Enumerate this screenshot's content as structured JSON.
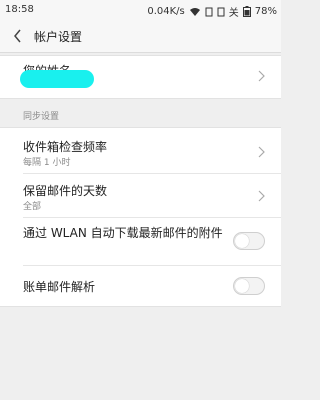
{
  "status_bar": {
    "time": "18:58",
    "speed": "0.04K/s",
    "icons": [
      "wifi-icon",
      "sim-icon",
      "sim2-icon",
      "battery-icon"
    ],
    "alarm": "关",
    "battery": "78%"
  },
  "header": {
    "title": "帐户设置"
  },
  "profile": {
    "name_label": "您的姓名"
  },
  "sync": {
    "section_title": "同步设置",
    "items": [
      {
        "label": "收件箱检查频率",
        "value": "每隔 1 小时"
      },
      {
        "label": "保留邮件的天数",
        "value": "全部"
      },
      {
        "label": "通过 WLAN 自动下载最新邮件的附件",
        "toggle": false
      },
      {
        "label": "账单邮件解析",
        "toggle": false
      }
    ]
  },
  "colors": {
    "redaction": "#19f0ee",
    "background": "#efefef"
  }
}
